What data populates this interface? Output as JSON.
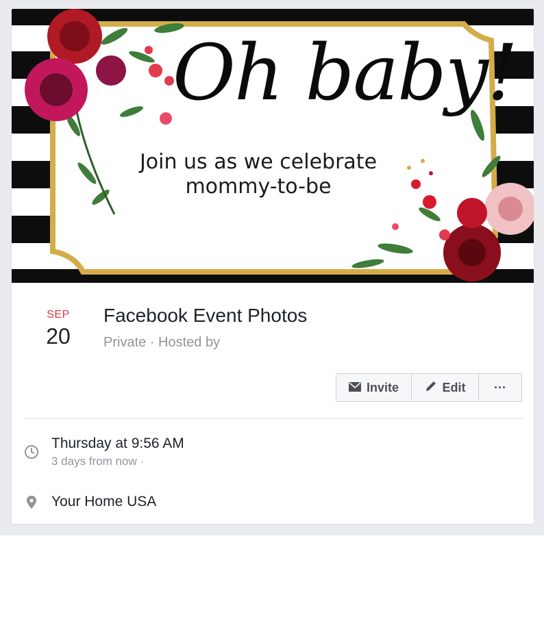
{
  "cover": {
    "headline": "Oh baby!",
    "line1": "Join us as we celebrate",
    "line2": "mommy-to-be"
  },
  "event": {
    "month": "SEP",
    "day": "20",
    "title": "Facebook Event Photos",
    "meta": "Private · Hosted by"
  },
  "actions": {
    "invite_label": "Invite",
    "edit_label": "Edit",
    "more_label": "···"
  },
  "details": {
    "time_main": "Thursday at 9:56 AM",
    "time_sub": "3 days from now ·",
    "location": "Your Home USA"
  },
  "icons": {
    "invite": "envelope-icon",
    "edit": "pencil-icon",
    "time": "clock-icon",
    "location": "map-pin-icon"
  },
  "colors": {
    "month": "#e0393e",
    "text": "#1d2129",
    "muted": "#90949c",
    "gold_frame": "#d4ad4a",
    "page_bg": "#e9ebee"
  }
}
